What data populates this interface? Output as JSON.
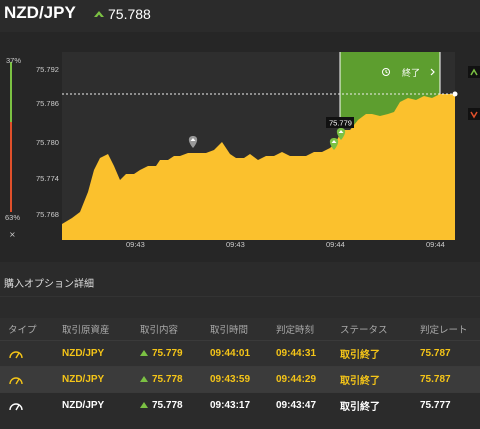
{
  "header": {
    "pair": "NZD/JPY",
    "price": "75.788",
    "price_icon": "up-arrow-icon"
  },
  "meter": {
    "top_pct": "37%",
    "bottom_pct": "63%",
    "close": "×"
  },
  "chart": {
    "y_ticks": [
      "75.792",
      "75.786",
      "75.780",
      "75.774",
      "75.768"
    ],
    "x_ticks": [
      "09:43",
      "09:43",
      "09:44",
      "09:44"
    ],
    "tooltip": "75.779",
    "end_label": "終了",
    "colors": {
      "area": "#fbc12d",
      "green": "#5d9e2f",
      "bg": "#262626"
    }
  },
  "section": {
    "title": "購入オプション詳細"
  },
  "table": {
    "headers": [
      "タイプ",
      "取引原資産",
      "取引内容",
      "取引時間",
      "判定時刻",
      "ステータス",
      "判定レート"
    ],
    "rows": [
      {
        "asset": "NZD/JPY",
        "content": "75.779",
        "time": "09:44:01",
        "judge": "09:44:31",
        "status": "取引終了",
        "rate": "75.787"
      },
      {
        "asset": "NZD/JPY",
        "content": "75.778",
        "time": "09:43:59",
        "judge": "09:44:29",
        "status": "取引終了",
        "rate": "75.787"
      },
      {
        "asset": "NZD/JPY",
        "content": "75.778",
        "time": "09:43:17",
        "judge": "09:43:47",
        "status": "取引終了",
        "rate": "75.777"
      }
    ]
  }
}
